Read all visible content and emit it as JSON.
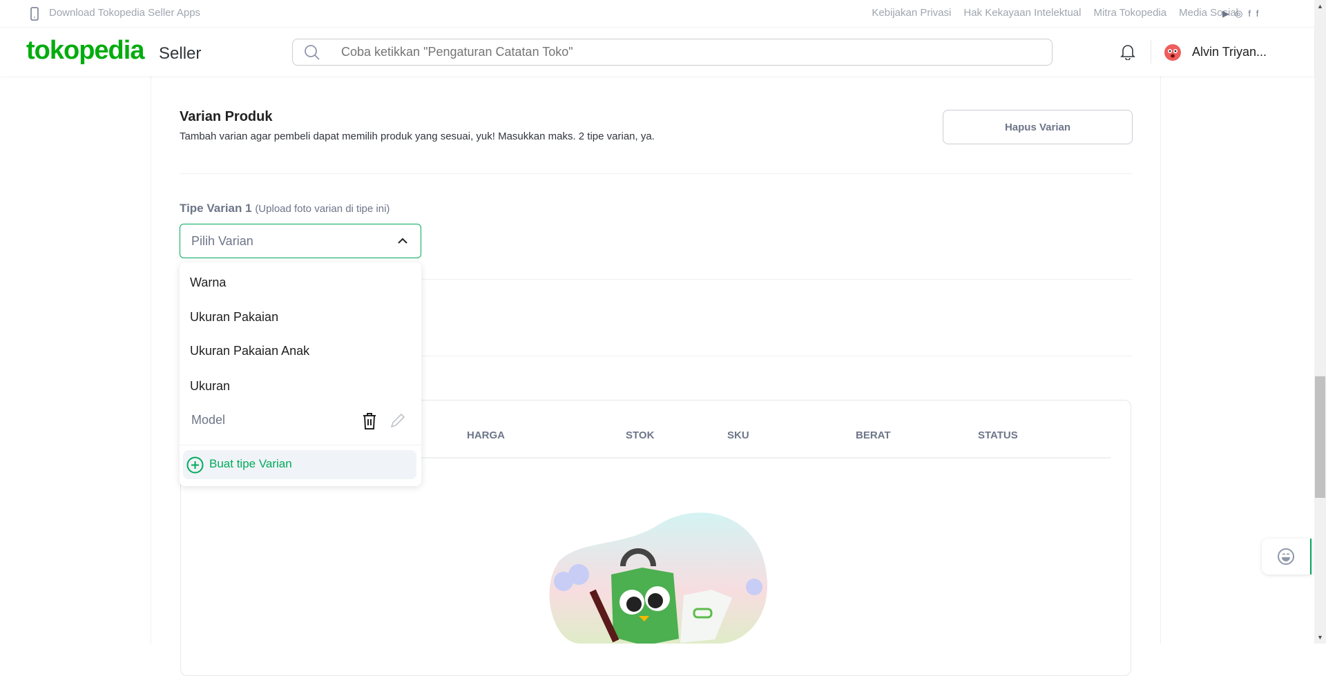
{
  "topbar": {
    "download": "Download Tokopedia Seller Apps",
    "links": [
      "Kebijakan Privasi",
      "Hak Kekayaan Intelektual",
      "Mitra Tokopedia",
      "Media Sosial"
    ]
  },
  "header": {
    "logo": "tokopedia",
    "logo_suffix": "Seller",
    "search_placeholder": "Coba ketikkan \"Pengaturan Catatan Toko\"",
    "user_name": "Alvin Triyan..."
  },
  "variant": {
    "title": "Varian Produk",
    "subtitle": "Tambah varian agar pembeli dapat memilih produk yang sesuai, yuk! Masukkan maks. 2 tipe varian, ya.",
    "delete_button": "Hapus Varian",
    "type_label": "Tipe Varian 1",
    "type_hint": "(Upload foto varian di tipe ini)",
    "select_placeholder": "Pilih Varian"
  },
  "dropdown": {
    "options": [
      "Warna",
      "Ukuran Pakaian",
      "Ukuran Pakaian Anak",
      "Ukuran",
      "Model"
    ],
    "create_label": "Buat tipe Varian"
  },
  "table": {
    "columns": [
      "HARGA",
      "STOK",
      "SKU",
      "BERAT",
      "STATUS"
    ]
  },
  "colors": {
    "brand": "#03ac0e",
    "accent": "#00aa5b"
  }
}
